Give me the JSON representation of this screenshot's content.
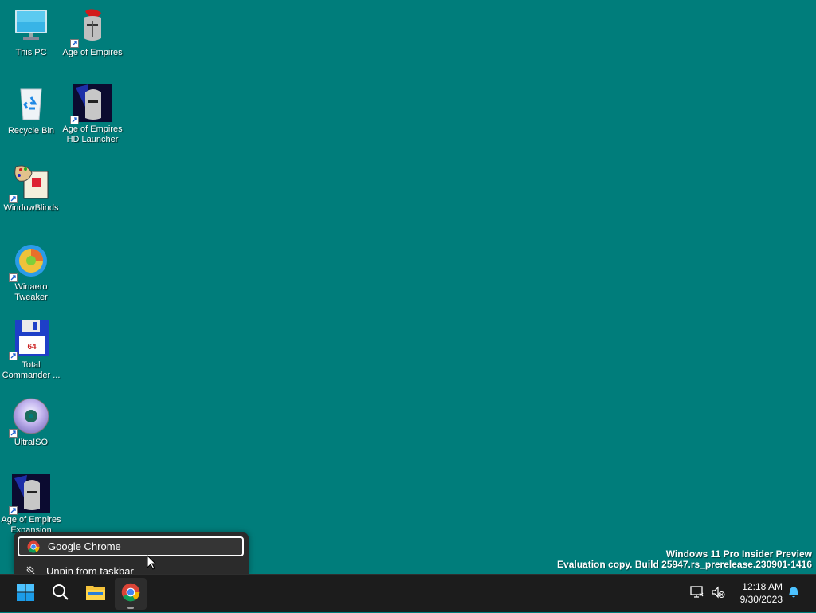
{
  "desktop": {
    "icons": [
      {
        "label": "This PC"
      },
      {
        "label": "Age of Empires"
      },
      {
        "label": "Recycle Bin"
      },
      {
        "label": "Age of Empires HD Launcher"
      },
      {
        "label": "WindowBlinds"
      },
      {
        "label": "Winaero Tweaker"
      },
      {
        "label": "Total Commander ..."
      },
      {
        "label": "UltraISO"
      },
      {
        "label": "Age of Empires Expansion"
      }
    ],
    "background_color": "#007d7b"
  },
  "watermark": {
    "line1": "Windows 11 Pro Insider Preview",
    "line2": "Evaluation copy. Build 25947.rs_prerelease.230901-1416"
  },
  "jumplist": {
    "items": [
      {
        "label": "Google Chrome",
        "icon": "chrome-icon"
      },
      {
        "label": "Unpin from taskbar",
        "icon": "unpin-icon"
      }
    ]
  },
  "taskbar": {
    "buttons": [
      {
        "name": "Start",
        "icon": "windows-start-icon"
      },
      {
        "name": "Search",
        "icon": "search-icon"
      },
      {
        "name": "File Explorer",
        "icon": "folder-icon"
      },
      {
        "name": "Google Chrome",
        "icon": "chrome-icon"
      }
    ],
    "tray": {
      "time": "12:18 AM",
      "date": "9/30/2023",
      "icons": [
        "network-icon",
        "volume-muted-icon",
        "notification-bell-icon"
      ]
    }
  }
}
